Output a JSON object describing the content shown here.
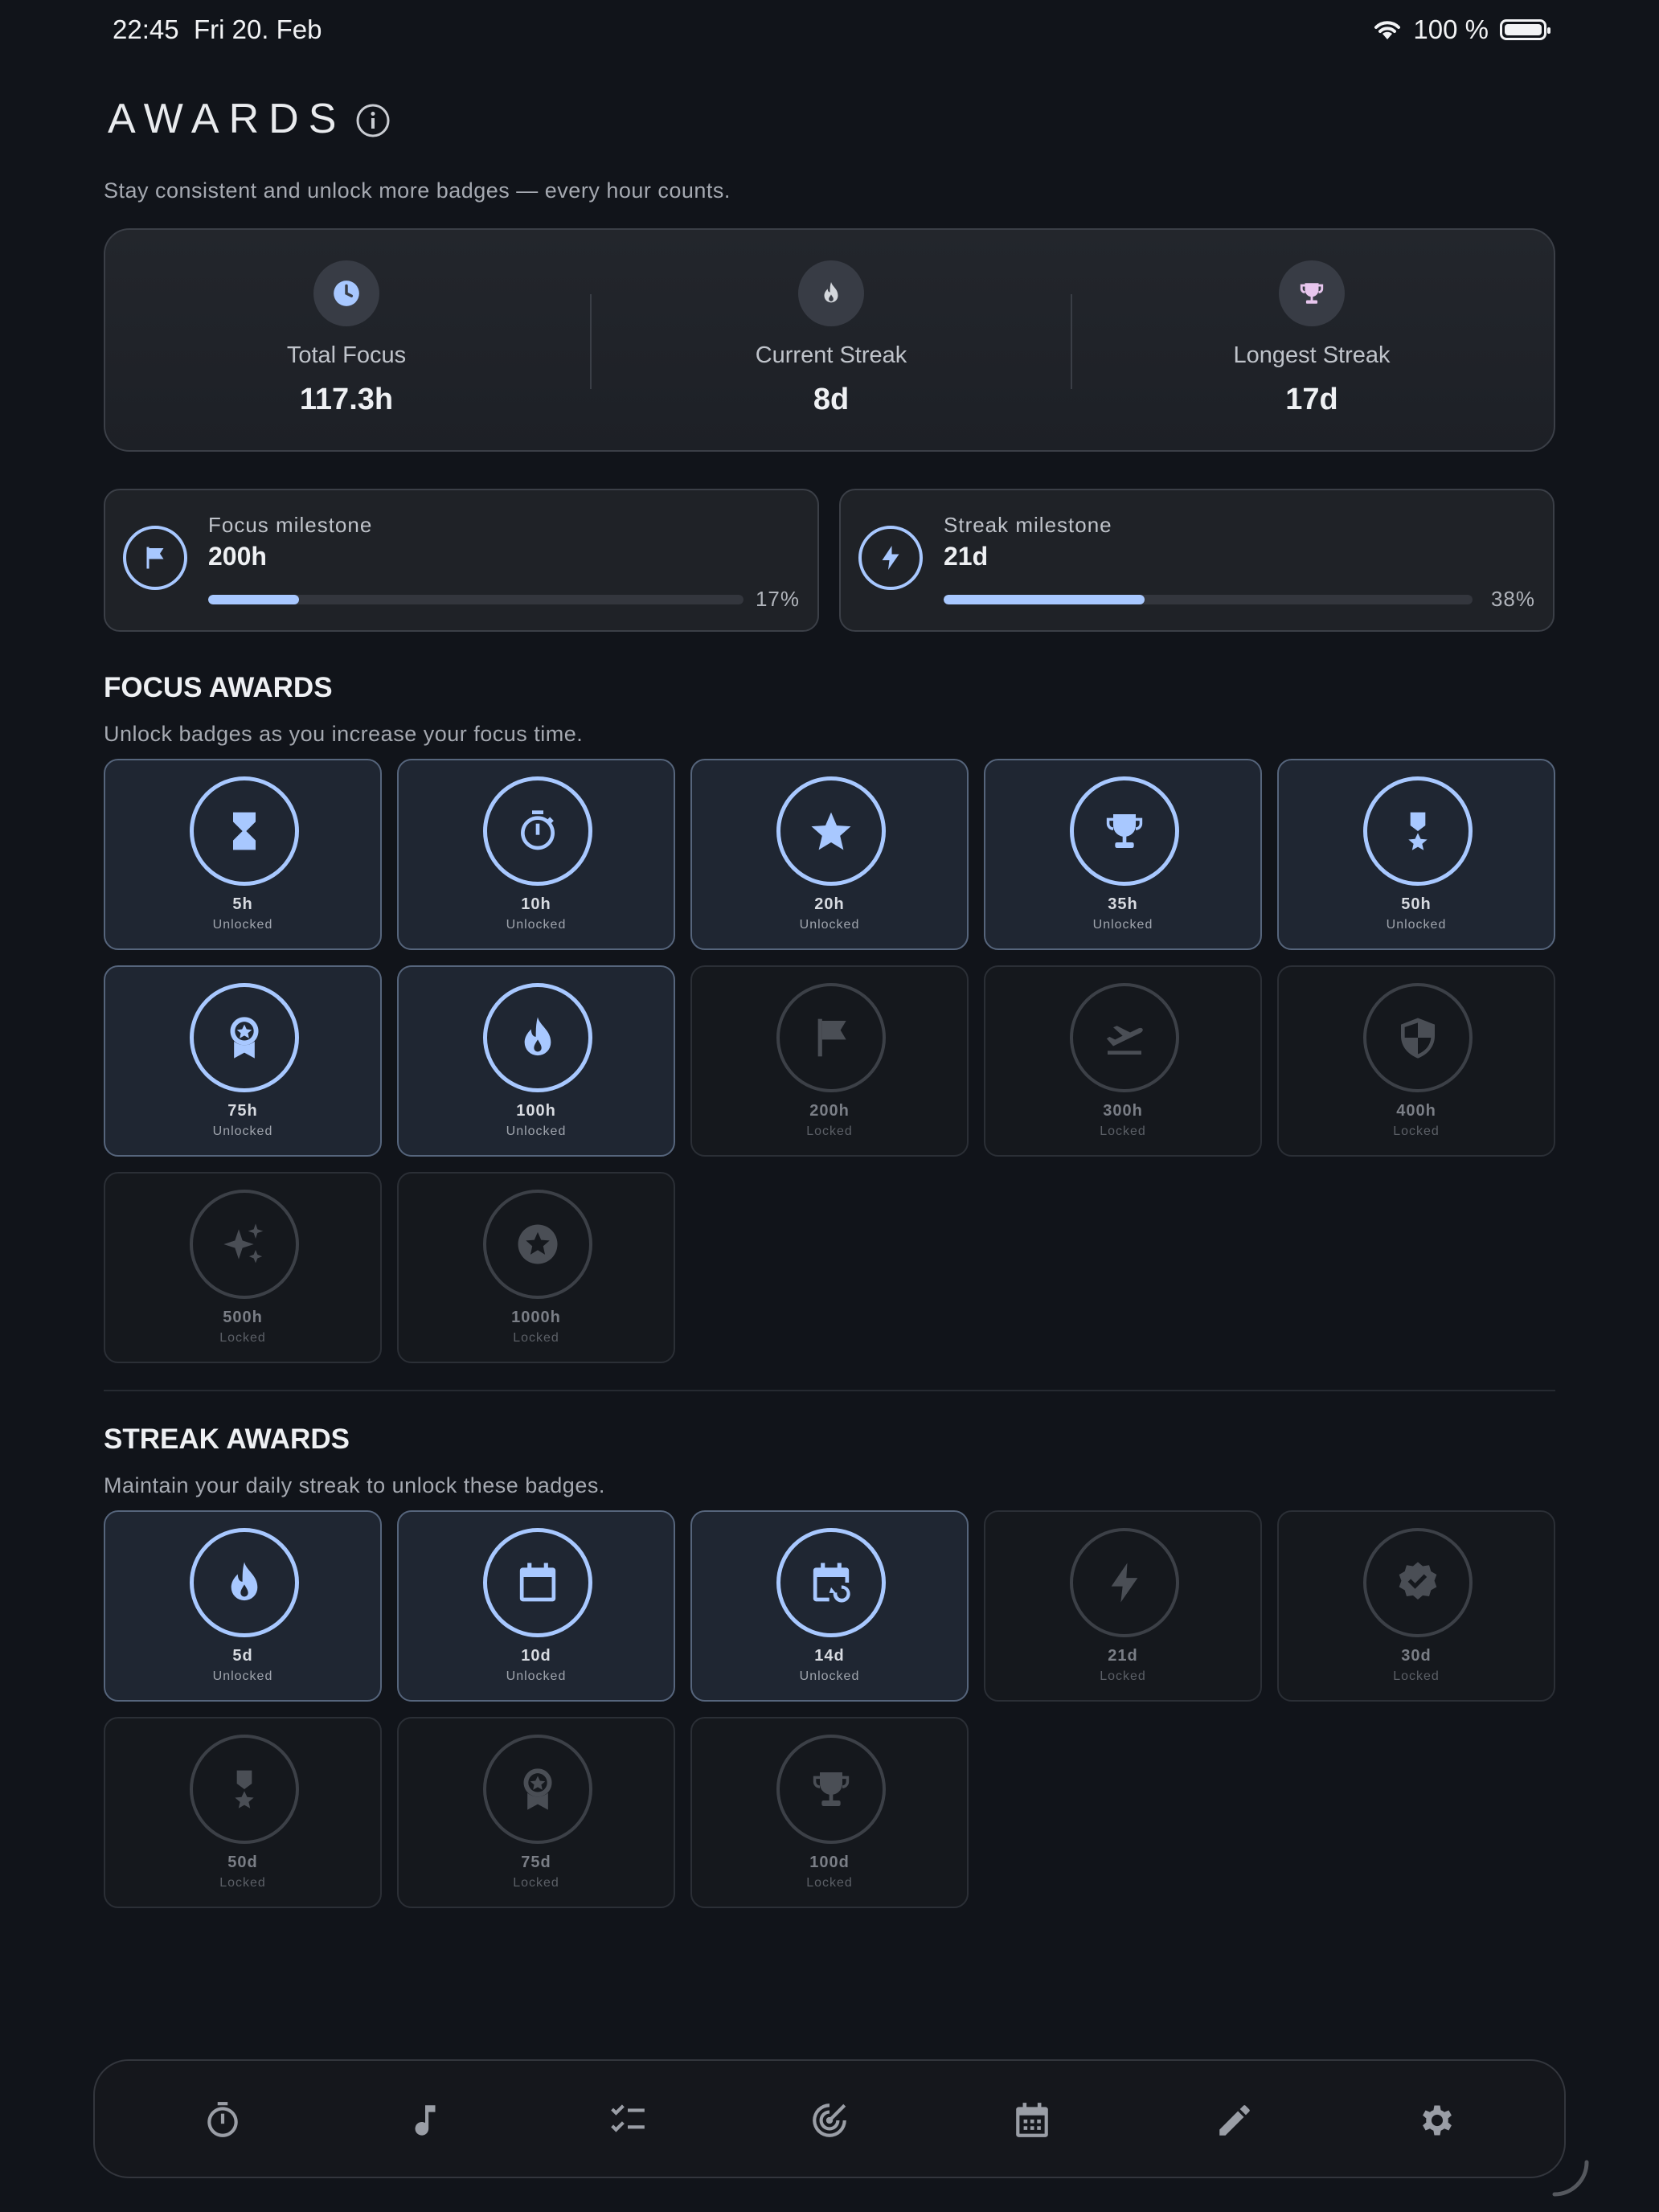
{
  "status_bar": {
    "time": "22:45",
    "date": "Fri 20. Feb",
    "battery": "100 %"
  },
  "header": {
    "title": "AWARDS",
    "subtitle": "Stay consistent and unlock more badges — every hour counts."
  },
  "stats": [
    {
      "label": "Total Focus",
      "value": "117.3h",
      "icon": "clock-icon"
    },
    {
      "label": "Current Streak",
      "value": "8d",
      "icon": "flame-icon"
    },
    {
      "label": "Longest Streak",
      "value": "17d",
      "icon": "trophy-icon"
    }
  ],
  "milestones": [
    {
      "label": "Focus milestone",
      "value": "200h",
      "percent_text": "17%",
      "progress": 0.17,
      "icon": "flag-icon"
    },
    {
      "label": "Streak milestone",
      "value": "21d",
      "percent_text": "38%",
      "progress": 0.38,
      "icon": "bolt-icon"
    }
  ],
  "focus_section": {
    "title": "FOCUS AWARDS",
    "subtitle": "Unlock badges as you increase your focus time.",
    "badges": [
      {
        "label": "5h",
        "status": "Unlocked",
        "icon": "hourglass"
      },
      {
        "label": "10h",
        "status": "Unlocked",
        "icon": "stopwatch"
      },
      {
        "label": "20h",
        "status": "Unlocked",
        "icon": "star"
      },
      {
        "label": "35h",
        "status": "Unlocked",
        "icon": "trophy"
      },
      {
        "label": "50h",
        "status": "Unlocked",
        "icon": "medal"
      },
      {
        "label": "75h",
        "status": "Unlocked",
        "icon": "award-ribbon"
      },
      {
        "label": "100h",
        "status": "Unlocked",
        "icon": "flame"
      },
      {
        "label": "200h",
        "status": "Locked",
        "icon": "flag"
      },
      {
        "label": "300h",
        "status": "Locked",
        "icon": "plane-takeoff"
      },
      {
        "label": "400h",
        "status": "Locked",
        "icon": "shield"
      },
      {
        "label": "500h",
        "status": "Locked",
        "icon": "sparkles"
      },
      {
        "label": "1000h",
        "status": "Locked",
        "icon": "star-circle"
      }
    ]
  },
  "streak_section": {
    "title": "STREAK AWARDS",
    "subtitle": "Maintain your daily streak to unlock these badges.",
    "badges": [
      {
        "label": "5d",
        "status": "Unlocked",
        "icon": "flame"
      },
      {
        "label": "10d",
        "status": "Unlocked",
        "icon": "calendar"
      },
      {
        "label": "14d",
        "status": "Unlocked",
        "icon": "calendar-repeat"
      },
      {
        "label": "21d",
        "status": "Locked",
        "icon": "bolt"
      },
      {
        "label": "30d",
        "status": "Locked",
        "icon": "verified"
      },
      {
        "label": "50d",
        "status": "Locked",
        "icon": "medal"
      },
      {
        "label": "75d",
        "status": "Locked",
        "icon": "award-ribbon"
      },
      {
        "label": "100d",
        "status": "Locked",
        "icon": "trophy"
      }
    ]
  },
  "nav": [
    {
      "name": "timer",
      "icon": "stopwatch-icon"
    },
    {
      "name": "music",
      "icon": "music-note-icon"
    },
    {
      "name": "tasks",
      "icon": "checklist-icon"
    },
    {
      "name": "focus",
      "icon": "target-icon"
    },
    {
      "name": "calendar",
      "icon": "calendar-icon"
    },
    {
      "name": "notes",
      "icon": "pencil-icon"
    },
    {
      "name": "settings",
      "icon": "gear-icon"
    }
  ],
  "colors": {
    "accent": "#a8c8ff",
    "background": "#11141a",
    "locked": "#4a4e55"
  }
}
